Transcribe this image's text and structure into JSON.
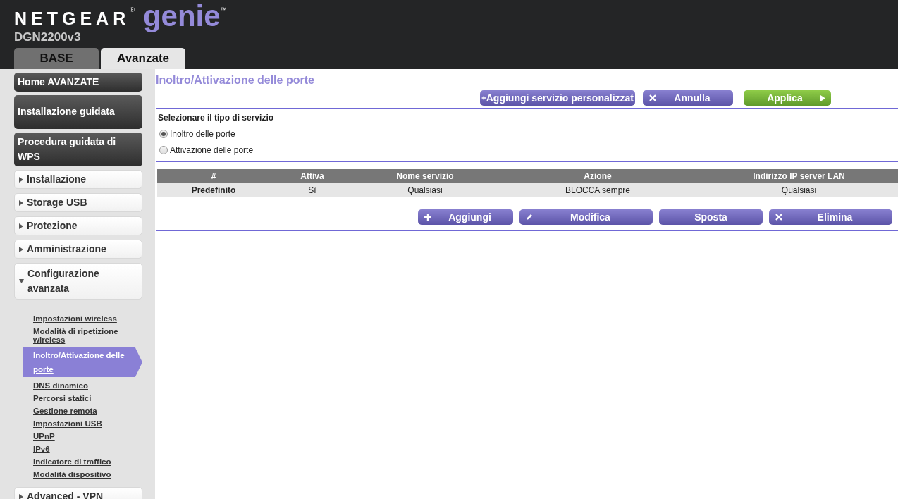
{
  "header": {
    "brand": "NETGEAR",
    "brand_mark": "®",
    "product": "genie",
    "product_mark": "™",
    "model": "DGN2200v3"
  },
  "tabs": [
    {
      "label": "BASE",
      "selected": false
    },
    {
      "label": "Avanzate",
      "selected": true
    }
  ],
  "sidebar": {
    "items": [
      {
        "kind": "dark",
        "label": "Home AVANZATE"
      },
      {
        "kind": "dark",
        "label": "Installazione guidata",
        "tall": true
      },
      {
        "kind": "dark",
        "label": "Procedura guidata di WPS"
      },
      {
        "kind": "section",
        "label": "Installazione",
        "expanded": false
      },
      {
        "kind": "section",
        "label": "Storage USB",
        "expanded": false
      },
      {
        "kind": "section",
        "label": "Protezione",
        "expanded": false
      },
      {
        "kind": "section",
        "label": "Amministrazione",
        "expanded": false
      },
      {
        "kind": "section",
        "label": "Configurazione avanzata",
        "expanded": true,
        "children": [
          {
            "label": "Impostazioni wireless",
            "selected": false
          },
          {
            "label": "Modalità di ripetizione wireless",
            "selected": false
          },
          {
            "label": "Inoltro/Attivazione delle porte",
            "selected": true
          },
          {
            "label": "DNS dinamico",
            "selected": false
          },
          {
            "label": "Percorsi statici",
            "selected": false
          },
          {
            "label": "Gestione remota",
            "selected": false
          },
          {
            "label": "Impostazioni USB",
            "selected": false
          },
          {
            "label": "UPnP",
            "selected": false
          },
          {
            "label": "IPv6",
            "selected": false
          },
          {
            "label": "Indicatore di traffico",
            "selected": false
          },
          {
            "label": "Modalità dispositivo",
            "selected": false
          }
        ]
      },
      {
        "kind": "section",
        "label": "Advanced - VPN",
        "expanded": false
      }
    ]
  },
  "page": {
    "title": "Inoltro/Attivazione delle porte",
    "top_buttons": [
      {
        "label": "Aggiungi servizio personalizzat",
        "kind": "add"
      },
      {
        "label": "Annulla",
        "kind": "cancel"
      },
      {
        "label": "Applica",
        "kind": "apply"
      }
    ],
    "service_type": {
      "label": "Selezionare il tipo di servizio",
      "options": [
        {
          "label": "Inoltro delle porte",
          "selected": true
        },
        {
          "label": "Attivazione delle porte",
          "selected": false
        }
      ]
    },
    "table": {
      "columns": [
        "#",
        "Attiva",
        "Nome servizio",
        "Azione",
        "Indirizzo IP server LAN"
      ],
      "rows": [
        [
          "Predefinito",
          "Sì",
          "Qualsiasi",
          "BLOCCA sempre",
          "Qualsiasi"
        ]
      ]
    },
    "bottom_buttons": [
      {
        "label": "Aggiungi",
        "kind": "add"
      },
      {
        "label": "Modifica",
        "kind": "edit"
      },
      {
        "label": "Sposta",
        "kind": "move"
      },
      {
        "label": "Elimina",
        "kind": "delete"
      }
    ]
  }
}
